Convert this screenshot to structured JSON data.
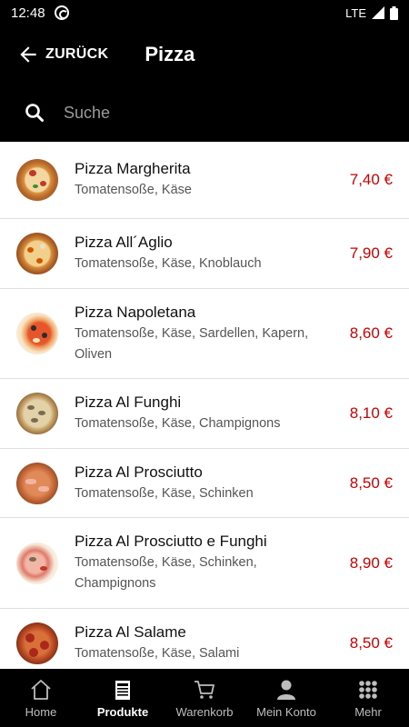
{
  "status": {
    "time": "12:48",
    "network": "LTE"
  },
  "header": {
    "back_label": "ZURÜCK",
    "title": "Pizza"
  },
  "search": {
    "placeholder": "Suche"
  },
  "colors": {
    "price": "#cc0000",
    "background": "#000000"
  },
  "products": [
    {
      "name": "Pizza Margherita",
      "desc": "Tomatensoße, Käse",
      "price": "7,40 €"
    },
    {
      "name": "Pizza All´Aglio",
      "desc": "Tomatensoße, Käse, Knoblauch",
      "price": "7,90 €"
    },
    {
      "name": "Pizza Napoletana",
      "desc": "Tomatensoße, Käse, Sardellen, Kapern, Oliven",
      "price": "8,60 €"
    },
    {
      "name": "Pizza Al Funghi",
      "desc": "Tomatensoße, Käse, Champignons",
      "price": "8,10 €"
    },
    {
      "name": "Pizza Al Prosciutto",
      "desc": "Tomatensoße, Käse, Schinken",
      "price": "8,50 €"
    },
    {
      "name": "Pizza Al Prosciutto e Funghi",
      "desc": "Tomatensoße, Käse, Schinken, Champignons",
      "price": "8,90 €"
    },
    {
      "name": "Pizza Al Salame",
      "desc": "Tomatensoße, Käse, Salami",
      "price": "8,50 €"
    }
  ],
  "tabs": [
    {
      "label": "Home",
      "icon": "home-icon"
    },
    {
      "label": "Produkte",
      "icon": "menu-card-icon",
      "active": true
    },
    {
      "label": "Warenkorb",
      "icon": "cart-icon"
    },
    {
      "label": "Mein Konto",
      "icon": "user-icon"
    },
    {
      "label": "Mehr",
      "icon": "grid-dots-icon"
    }
  ]
}
